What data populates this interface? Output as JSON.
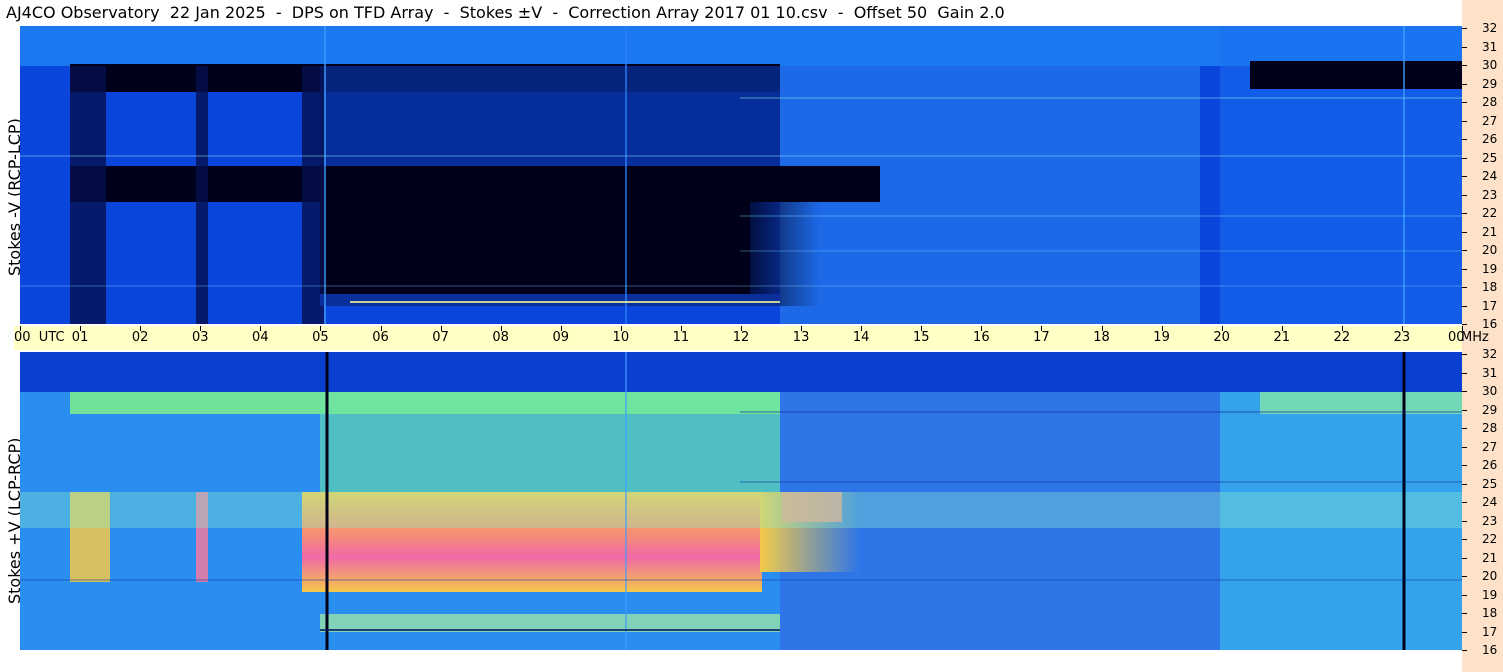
{
  "title": "AJ4CO Observatory  22 Jan 2025  -  DPS on TFD Array  -  Stokes ±V  -  Correction Array 2017 01 10.csv  -  Offset 50  Gain 2.0",
  "chart_data": [
    {
      "type": "heatmap",
      "panel": "top",
      "ylabel": "Stokes -V (RCP-LCP)",
      "y_unit": "MHz",
      "y_range": [
        16,
        32
      ],
      "y_ticks": [
        "32",
        "31",
        "30",
        "29",
        "28",
        "27",
        "26",
        "25",
        "24",
        "23",
        "22",
        "21",
        "20",
        "19",
        "18",
        "17",
        "16"
      ],
      "x_range_utc": [
        0,
        24
      ]
    },
    {
      "type": "heatmap",
      "panel": "bottom",
      "ylabel": "Stokes +V (LCP-RCP)",
      "y_unit": "MHz",
      "y_range": [
        16,
        32
      ],
      "y_ticks": [
        "32",
        "31",
        "30",
        "29",
        "28",
        "27",
        "26",
        "25",
        "24",
        "23",
        "22",
        "21",
        "20",
        "19",
        "18",
        "17",
        "16"
      ],
      "x_range_utc": [
        0,
        24
      ]
    }
  ],
  "time_axis": {
    "labels": [
      "00  UTC",
      "01",
      "02",
      "03",
      "04",
      "05",
      "06",
      "07",
      "08",
      "09",
      "10",
      "11",
      "12",
      "13",
      "14",
      "15",
      "16",
      "17",
      "18",
      "19",
      "20",
      "21",
      "22",
      "23",
      "00"
    ],
    "unit": "MHz"
  },
  "colors": {
    "background": "#ffffff",
    "time_band": "#ffffc6",
    "right_band": "#fde2c9"
  }
}
